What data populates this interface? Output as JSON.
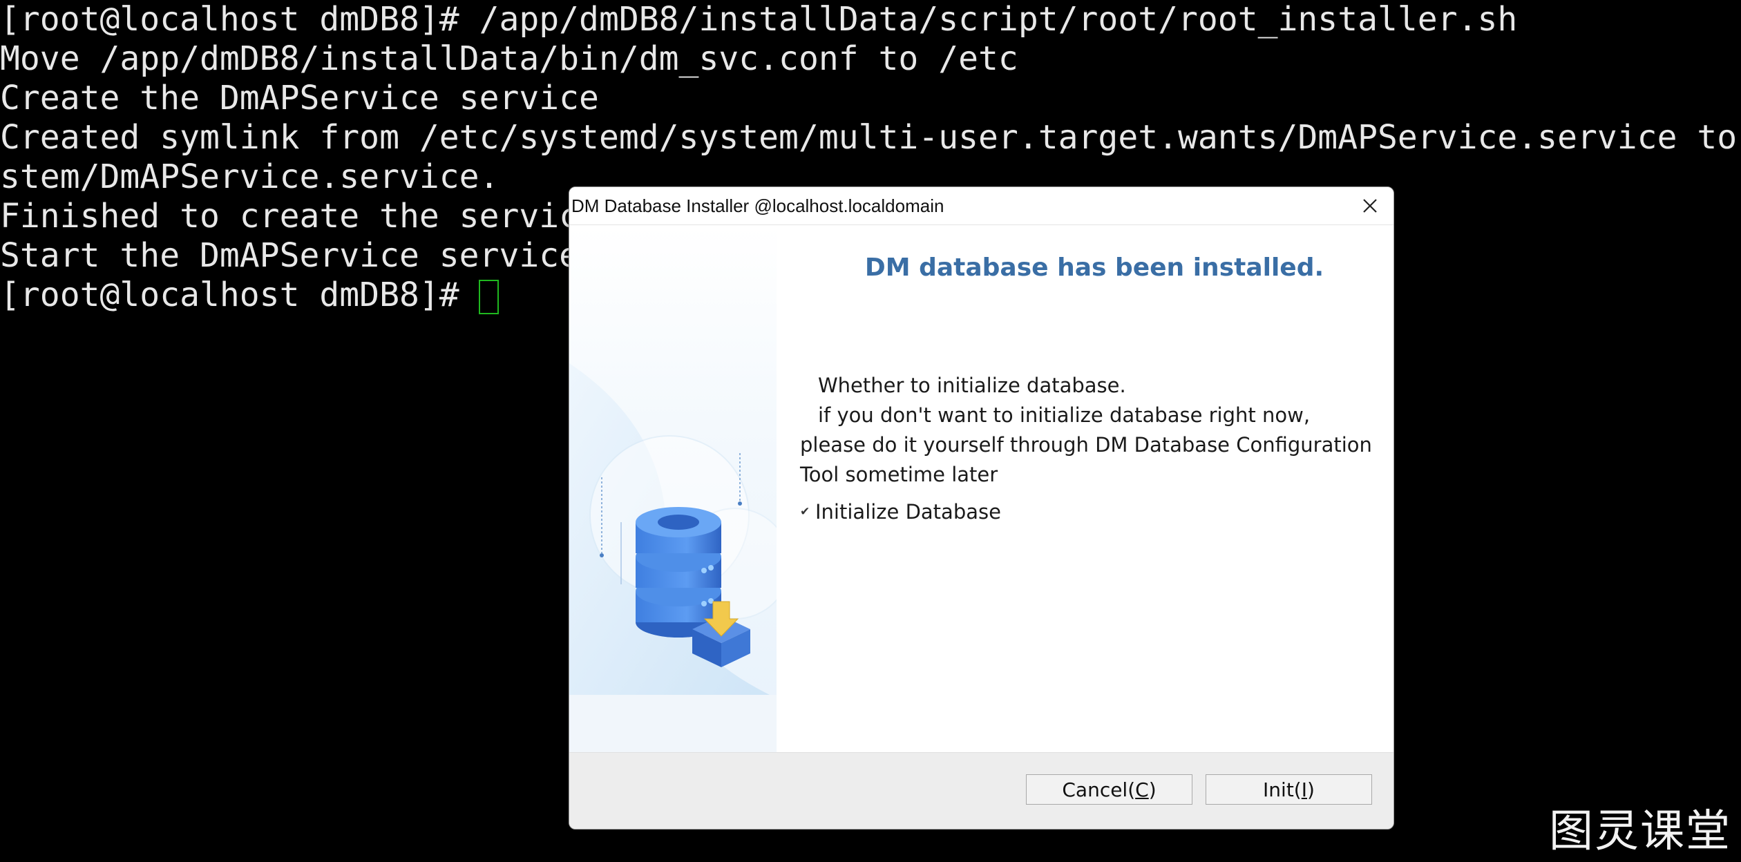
{
  "terminal": {
    "lines": [
      "[root@localhost dmDB8]# /app/dmDB8/installData/script/root/root_installer.sh",
      "Move /app/dmDB8/installData/bin/dm_svc.conf to /etc",
      "Create the DmAPService service",
      "Created symlink from /etc/systemd/system/multi-user.target.wants/DmAPService.service to",
      "stem/DmAPService.service.",
      "Finished to create the servic",
      "Start the DmAPService service"
    ],
    "prompt": "[root@localhost dmDB8]#",
    "cursor_color": "#1fb81f"
  },
  "dialog": {
    "title": "DM Database Installer @localhost.localdomain",
    "heading": "DM database has been installed.",
    "heading_color": "#3a6ea5",
    "message_lines": [
      "Whether to initialize database.",
      "if you don't want to initialize database right now,",
      "please do it yourself through DM Database Configuration",
      "Tool sometime later"
    ],
    "checkbox": {
      "label": "Initialize Database",
      "checked": true
    },
    "buttons": {
      "cancel": {
        "prefix": "Cancel(",
        "mnemonic": "C",
        "suffix": ")"
      },
      "init": {
        "prefix": "Init(",
        "mnemonic": "I",
        "suffix": ")"
      }
    },
    "close_icon": "close-icon",
    "illustration_icon": "database-install-illustration"
  },
  "watermark": "图灵课堂"
}
